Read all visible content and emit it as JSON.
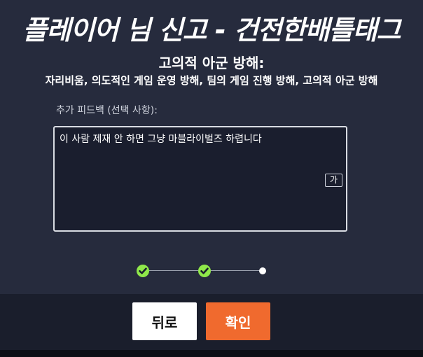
{
  "dialog": {
    "title": "플레이어 님 신고 - 건전한배틀태그",
    "category": "고의적 아군 방해:",
    "category_description": "자리비움, 의도적인 게임 운영 방해, 팀의 게임 진행 방해, 고의적 아군 방해",
    "feedback_label": "추가 피드백 (선택 사항):",
    "feedback_value": "이 사람 제재 안 하면 그냥 마블라이벌즈 하렵니다",
    "ime_indicator": "가"
  },
  "stepper": {
    "steps_total": 3,
    "steps_completed": 2,
    "current_step": 3
  },
  "buttons": {
    "back_label": "뒤로",
    "confirm_label": "확인"
  },
  "colors": {
    "background": "#262b3d",
    "footer": "#1a1e2c",
    "step_done": "#8fe84a",
    "confirm": "#f06a2e"
  }
}
